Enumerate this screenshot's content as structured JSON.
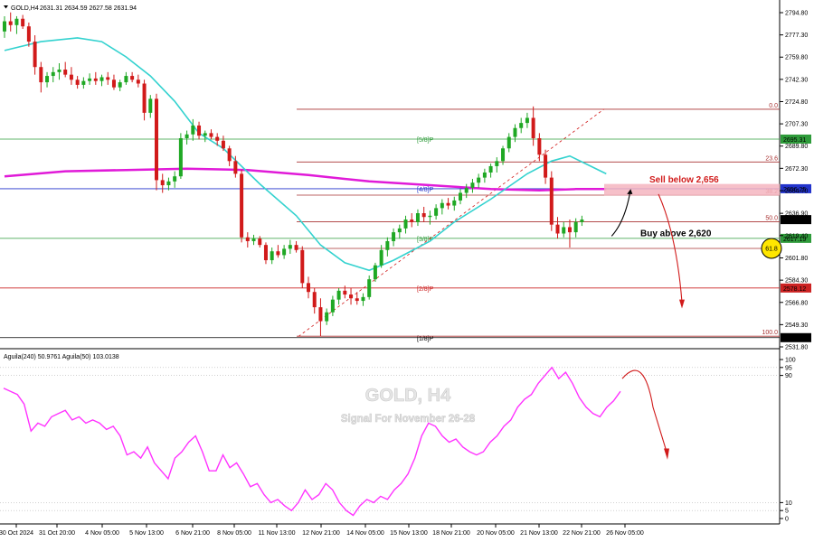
{
  "header": {
    "symbol_label": "GOLD,H4",
    "ohlc": "2631.31 2634.59 2627.58 2631.94"
  },
  "watermark": {
    "title": "GOLD, H4",
    "subtitle": "Signal For November 26-28"
  },
  "colors": {
    "bull": "#1fa824",
    "bear": "#d11a1a",
    "ma_cyan": "#33d2cf",
    "ma_magenta": "#e01ad8",
    "aguila": "#ff33ff",
    "fib_line": "#a83232",
    "murray_green": "#2e9b3a",
    "murray_blue": "#2233cc",
    "murray_red": "#cc2222",
    "sell_zone": "#f5b5bf",
    "circle_fill": "#ffe600"
  },
  "chart_data": [
    {
      "type": "candlestick",
      "title": "GOLD,H4",
      "ylim": [
        2531,
        2805
      ],
      "y_ticks": [
        "2794.80",
        "2777.30",
        "2759.80",
        "2742.30",
        "2724.80",
        "2707.30",
        "2689.80",
        "2672.30",
        "2654.70",
        "2636.90",
        "2619.40",
        "2601.80",
        "2584.30",
        "2566.80",
        "2549.30",
        "2531.80"
      ],
      "x_labels": [
        "30 Oct 2024",
        "31 Oct 20:00",
        "4 Nov 05:00",
        "5 Nov 13:00",
        "6 Nov 21:00",
        "8 Nov 05:00",
        "11 Nov 13:00",
        "12 Nov 21:00",
        "14 Nov 05:00",
        "15 Nov 13:00",
        "18 Nov 21:00",
        "20 Nov 05:00",
        "21 Nov 13:00",
        "22 Nov 21:00",
        "26 Nov 05:00"
      ],
      "candles": [
        [
          2780,
          2792,
          2775,
          2788
        ],
        [
          2788,
          2795,
          2780,
          2785
        ],
        [
          2785,
          2792,
          2778,
          2790
        ],
        [
          2790,
          2793,
          2782,
          2784
        ],
        [
          2784,
          2787,
          2768,
          2772
        ],
        [
          2772,
          2777,
          2746,
          2752
        ],
        [
          2752,
          2756,
          2732,
          2740
        ],
        [
          2740,
          2748,
          2736,
          2745
        ],
        [
          2745,
          2752,
          2740,
          2748
        ],
        [
          2748,
          2755,
          2742,
          2750
        ],
        [
          2750,
          2756,
          2744,
          2746
        ],
        [
          2746,
          2752,
          2738,
          2742
        ],
        [
          2742,
          2745,
          2735,
          2738
        ],
        [
          2738,
          2744,
          2735,
          2741
        ],
        [
          2741,
          2747,
          2738,
          2743
        ],
        [
          2743,
          2748,
          2738,
          2741
        ],
        [
          2741,
          2746,
          2737,
          2744
        ],
        [
          2744,
          2748,
          2738,
          2742
        ],
        [
          2742,
          2746,
          2734,
          2736
        ],
        [
          2736,
          2742,
          2733,
          2740
        ],
        [
          2740,
          2748,
          2738,
          2745
        ],
        [
          2745,
          2748,
          2740,
          2742
        ],
        [
          2742,
          2746,
          2736,
          2739
        ],
        [
          2739,
          2742,
          2710,
          2716
        ],
        [
          2716,
          2730,
          2712,
          2727
        ],
        [
          2727,
          2731,
          2655,
          2663
        ],
        [
          2663,
          2668,
          2653,
          2659
        ],
        [
          2659,
          2665,
          2655,
          2662
        ],
        [
          2662,
          2670,
          2657,
          2666
        ],
        [
          2666,
          2700,
          2664,
          2696
        ],
        [
          2696,
          2702,
          2691,
          2699
        ],
        [
          2699,
          2711,
          2694,
          2706
        ],
        [
          2706,
          2709,
          2695,
          2698
        ],
        [
          2698,
          2702,
          2693,
          2700
        ],
        [
          2700,
          2703,
          2695,
          2697
        ],
        [
          2697,
          2700,
          2690,
          2694
        ],
        [
          2694,
          2698,
          2686,
          2688
        ],
        [
          2688,
          2690,
          2674,
          2678
        ],
        [
          2678,
          2682,
          2665,
          2668
        ],
        [
          2668,
          2671,
          2614,
          2618
        ],
        [
          2618,
          2622,
          2610,
          2615
        ],
        [
          2615,
          2620,
          2612,
          2617
        ],
        [
          2617,
          2619,
          2610,
          2612
        ],
        [
          2612,
          2614,
          2597,
          2600
        ],
        [
          2600,
          2610,
          2597,
          2607
        ],
        [
          2607,
          2612,
          2602,
          2604
        ],
        [
          2604,
          2612,
          2601,
          2609
        ],
        [
          2609,
          2616,
          2605,
          2612
        ],
        [
          2612,
          2615,
          2606,
          2608
        ],
        [
          2608,
          2611,
          2578,
          2582
        ],
        [
          2582,
          2587,
          2570,
          2575
        ],
        [
          2575,
          2578,
          2558,
          2563
        ],
        [
          2563,
          2570,
          2540,
          2552
        ],
        [
          2552,
          2562,
          2549,
          2559
        ],
        [
          2559,
          2572,
          2556,
          2569
        ],
        [
          2569,
          2578,
          2565,
          2576
        ],
        [
          2576,
          2580,
          2570,
          2573
        ],
        [
          2573,
          2578,
          2565,
          2570
        ],
        [
          2570,
          2575,
          2565,
          2568
        ],
        [
          2568,
          2574,
          2564,
          2571
        ],
        [
          2571,
          2588,
          2569,
          2585
        ],
        [
          2585,
          2598,
          2583,
          2596
        ],
        [
          2596,
          2612,
          2594,
          2608
        ],
        [
          2608,
          2618,
          2603,
          2615
        ],
        [
          2615,
          2625,
          2611,
          2622
        ],
        [
          2622,
          2628,
          2617,
          2625
        ],
        [
          2625,
          2635,
          2621,
          2632
        ],
        [
          2632,
          2637,
          2626,
          2630
        ],
        [
          2630,
          2640,
          2627,
          2637
        ],
        [
          2637,
          2642,
          2630,
          2634
        ],
        [
          2634,
          2639,
          2628,
          2635
        ],
        [
          2635,
          2644,
          2632,
          2641
        ],
        [
          2641,
          2648,
          2636,
          2645
        ],
        [
          2645,
          2649,
          2640,
          2643
        ],
        [
          2643,
          2650,
          2639,
          2647
        ],
        [
          2647,
          2656,
          2644,
          2653
        ],
        [
          2653,
          2660,
          2649,
          2657
        ],
        [
          2657,
          2664,
          2653,
          2661
        ],
        [
          2661,
          2668,
          2657,
          2665
        ],
        [
          2665,
          2672,
          2661,
          2669
        ],
        [
          2669,
          2676,
          2665,
          2674
        ],
        [
          2674,
          2681,
          2669,
          2678
        ],
        [
          2678,
          2690,
          2675,
          2688
        ],
        [
          2688,
          2700,
          2685,
          2697
        ],
        [
          2697,
          2707,
          2693,
          2704
        ],
        [
          2704,
          2712,
          2700,
          2708
        ],
        [
          2708,
          2716,
          2704,
          2712
        ],
        [
          2712,
          2721,
          2690,
          2696
        ],
        [
          2696,
          2700,
          2678,
          2683
        ],
        [
          2683,
          2687,
          2660,
          2665
        ],
        [
          2665,
          2670,
          2623,
          2628
        ],
        [
          2628,
          2634,
          2617,
          2621
        ],
        [
          2621,
          2630,
          2618,
          2626
        ],
        [
          2626,
          2632,
          2610,
          2622
        ],
        [
          2622,
          2633,
          2618,
          2630
        ],
        [
          2630,
          2635,
          2627,
          2632
        ]
      ],
      "ma_cyan": [
        [
          0,
          2765
        ],
        [
          6,
          2772
        ],
        [
          12,
          2775
        ],
        [
          16,
          2772
        ],
        [
          20,
          2760
        ],
        [
          24,
          2745
        ],
        [
          28,
          2725
        ],
        [
          32,
          2700
        ],
        [
          36,
          2688
        ],
        [
          42,
          2660
        ],
        [
          48,
          2635
        ],
        [
          52,
          2612
        ],
        [
          56,
          2598
        ],
        [
          60,
          2592
        ],
        [
          64,
          2600
        ],
        [
          70,
          2615
        ],
        [
          74,
          2630
        ],
        [
          80,
          2648
        ],
        [
          86,
          2668
        ],
        [
          90,
          2678
        ],
        [
          93,
          2682
        ],
        [
          96,
          2675
        ],
        [
          99,
          2668
        ]
      ],
      "ma_magenta": [
        [
          0,
          2666
        ],
        [
          10,
          2670
        ],
        [
          20,
          2671
        ],
        [
          30,
          2672
        ],
        [
          40,
          2671
        ],
        [
          50,
          2667
        ],
        [
          60,
          2662
        ],
        [
          70,
          2659
        ],
        [
          80,
          2656
        ],
        [
          88,
          2655
        ],
        [
          94,
          2656
        ],
        [
          99,
          2656
        ]
      ],
      "annotations": {
        "sell_label": "Sell below 2,656",
        "buy_label": "Buy above 2,620",
        "sell_level": 2656,
        "buy_level": 2620,
        "circle_label": "61.8"
      },
      "fib_levels": [
        {
          "label": "0.0",
          "value": 2718.8
        },
        {
          "label": "23.6",
          "value": 2677.3
        },
        {
          "label": "38.2",
          "value": 2651.2
        },
        {
          "label": "50.0",
          "value": 2630.2
        },
        {
          "label": "61.8",
          "value": 2609.3
        },
        {
          "label": "100.0",
          "value": 2540.2
        }
      ],
      "murray_levels": [
        {
          "label": "[5/8]P",
          "value": 2695.31,
          "price": "2695.31",
          "color": "green"
        },
        {
          "label": "[4/8]P",
          "value": 2656.25,
          "price": "2656.25",
          "color": "blue"
        },
        {
          "label": "[3/8]P",
          "value": 2617.19,
          "price": "2617.19",
          "color": "green"
        },
        {
          "label": "[2/8]P",
          "value": 2578.12,
          "price": "2578.12",
          "color": "red"
        },
        {
          "label": "[1/8]P",
          "value": 2539.06,
          "price": "2539.06",
          "color": "black"
        }
      ],
      "current_price": "2631.94"
    },
    {
      "type": "line",
      "title": "Aguila(240) 50.9761 Aguila(50) 103.0138",
      "ylim": [
        0,
        100
      ],
      "y_ticks": [
        "100",
        "95",
        "90",
        "10",
        "5",
        "0"
      ],
      "series": [
        {
          "name": "Aguila(240)",
          "values": [
            82,
            80,
            78,
            72,
            55,
            60,
            58,
            64,
            66,
            68,
            62,
            64,
            60,
            62,
            60,
            56,
            58,
            52,
            40,
            42,
            38,
            45,
            35,
            30,
            25,
            38,
            42,
            48,
            52,
            42,
            30,
            30,
            40,
            32,
            35,
            28,
            20,
            22,
            15,
            10,
            12,
            8,
            5,
            10,
            18,
            12,
            15,
            22,
            18,
            10,
            5,
            2,
            8,
            12,
            10,
            14,
            12,
            18,
            22,
            28,
            38,
            52,
            60,
            58,
            52,
            48,
            50,
            45,
            42,
            40,
            42,
            48,
            52,
            58,
            62,
            70,
            75,
            78,
            85,
            90,
            95,
            88,
            92,
            85,
            76,
            70,
            66,
            64,
            70,
            74,
            80
          ]
        }
      ]
    }
  ]
}
